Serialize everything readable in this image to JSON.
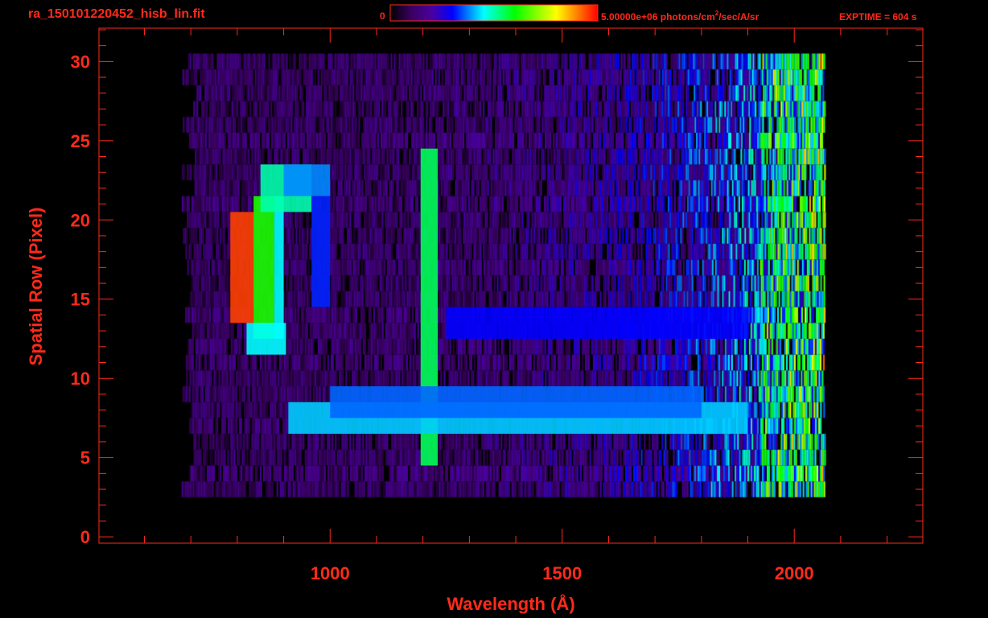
{
  "header": {
    "filename": "ra_150101220452_hisb_lin.fit",
    "colorbar_min": "0",
    "colorbar_max": "5.00000e+06 photons/cm",
    "colorbar_unit_sup": "2",
    "colorbar_unit_rest": "/sec/A/sr",
    "exptime": "EXPTIME = 604 s"
  },
  "colors": {
    "axis": "#ff2a1a",
    "background": "#000000",
    "colormap": [
      "#000000",
      "#3a0060",
      "#4a00a0",
      "#0000ff",
      "#00ffff",
      "#00ff00",
      "#ffff00",
      "#ff8000",
      "#ff0000"
    ]
  },
  "chart_data": {
    "type": "heatmap",
    "title": "ra_150101220452_hisb_lin.fit",
    "xlabel": "Wavelength (Å)",
    "ylabel": "Spatial Row (Pixel)",
    "xlim": [
      502,
      2277
    ],
    "ylim": [
      -0.4,
      32.1
    ],
    "xticks": [
      1000,
      1500,
      2000
    ],
    "yticks": [
      0,
      5,
      10,
      15,
      20,
      25,
      30
    ],
    "colorbar_range": [
      0,
      5000000
    ],
    "background": {
      "wavelength_range": [
        680,
        2065
      ],
      "rows": [
        3,
        30
      ],
      "level_low": 0.12,
      "level_high_near_2000A": 0.45
    },
    "features": [
      {
        "name": "arc-core",
        "wavelength": [
          785,
          835
        ],
        "rows": [
          14,
          20
        ],
        "level": 0.95
      },
      {
        "name": "arc-inner",
        "wavelength": [
          835,
          880
        ],
        "rows": [
          13,
          21
        ],
        "level": 0.62
      },
      {
        "name": "arc-outer",
        "wavelength": [
          880,
          900
        ],
        "rows": [
          13,
          21
        ],
        "level": 0.45
      },
      {
        "name": "arc-top",
        "wavelength": [
          850,
          960
        ],
        "rows": [
          21,
          23
        ],
        "level": 0.5
      },
      {
        "name": "arc-top-edge",
        "wavelength": [
          900,
          1000
        ],
        "rows": [
          22,
          23
        ],
        "level": 0.38
      },
      {
        "name": "arc-bottom",
        "wavelength": [
          820,
          905
        ],
        "rows": [
          12,
          13
        ],
        "level": 0.45
      },
      {
        "name": "arc-upper-right",
        "wavelength": [
          960,
          1000
        ],
        "rows": [
          15,
          21
        ],
        "level": 0.32
      },
      {
        "name": "lyman-alpha-line",
        "wavelength": [
          1195,
          1232
        ],
        "rows": [
          5,
          24
        ],
        "level": 0.55
      },
      {
        "name": "band-row-7",
        "wavelength": [
          910,
          1900
        ],
        "rows": [
          7,
          8
        ],
        "level": 0.42
      },
      {
        "name": "band-row-8",
        "wavelength": [
          1000,
          1800
        ],
        "rows": [
          8,
          9
        ],
        "level": 0.36
      },
      {
        "name": "band-row-13",
        "wavelength": [
          1250,
          1900
        ],
        "rows": [
          13,
          14
        ],
        "level": 0.3
      }
    ]
  }
}
